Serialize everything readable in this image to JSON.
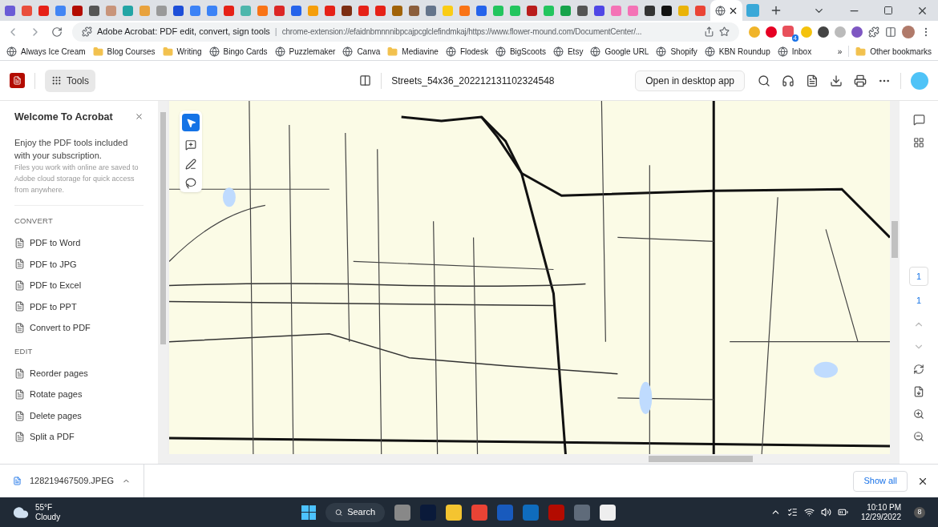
{
  "browser": {
    "address_title": "Adobe Acrobat: PDF edit, convert, sign tools",
    "separator": "|",
    "url": "chrome-extension://efaidnbmnnnibpcajpcglclefindmkaj/https://www.flower-mound.com/DocumentCenter/...",
    "extension_badge": "4"
  },
  "bookmarks": [
    {
      "label": "Always Ice Cream",
      "kind": "site"
    },
    {
      "label": "Blog Courses",
      "kind": "folder"
    },
    {
      "label": "Writing",
      "kind": "folder"
    },
    {
      "label": "Bingo Cards",
      "kind": "site"
    },
    {
      "label": "Puzzlemaker",
      "kind": "site"
    },
    {
      "label": "Canva",
      "kind": "site"
    },
    {
      "label": "Mediavine",
      "kind": "folder"
    },
    {
      "label": "Flodesk",
      "kind": "site"
    },
    {
      "label": "BigScoots",
      "kind": "site"
    },
    {
      "label": "Etsy",
      "kind": "site"
    },
    {
      "label": "Google URL",
      "kind": "site"
    },
    {
      "label": "Shopify",
      "kind": "site"
    },
    {
      "label": "KBN Roundup",
      "kind": "site"
    },
    {
      "label": "Inbox",
      "kind": "site"
    }
  ],
  "other_bookmarks": "Other bookmarks",
  "more_bookmarks": "»",
  "acrobat": {
    "tools_label": "Tools",
    "file_name": "Streets_54x36_202212131102324548",
    "open_desktop": "Open in desktop app"
  },
  "panel": {
    "title": "Welcome To Acrobat",
    "intro": "Enjoy the PDF tools included with your subscription.",
    "note": "Files you work with online are saved to Adobe cloud storage for quick access from anywhere.",
    "sections": [
      {
        "heading": "CONVERT",
        "items": [
          "PDF to Word",
          "PDF to JPG",
          "PDF to Excel",
          "PDF to PPT",
          "Convert to PDF"
        ]
      },
      {
        "heading": "EDIT",
        "items": [
          "Reorder pages",
          "Rotate pages",
          "Delete pages",
          "Split a PDF"
        ]
      }
    ]
  },
  "page_nav": {
    "current": "1",
    "total": "1"
  },
  "downloads": {
    "file": "128219467509.JPEG",
    "show_all": "Show all"
  },
  "taskbar": {
    "temperature": "55°F",
    "weather": "Cloudy",
    "search": "Search",
    "time": "10:10 PM",
    "date": "12/29/2022",
    "notification_count": "8"
  }
}
